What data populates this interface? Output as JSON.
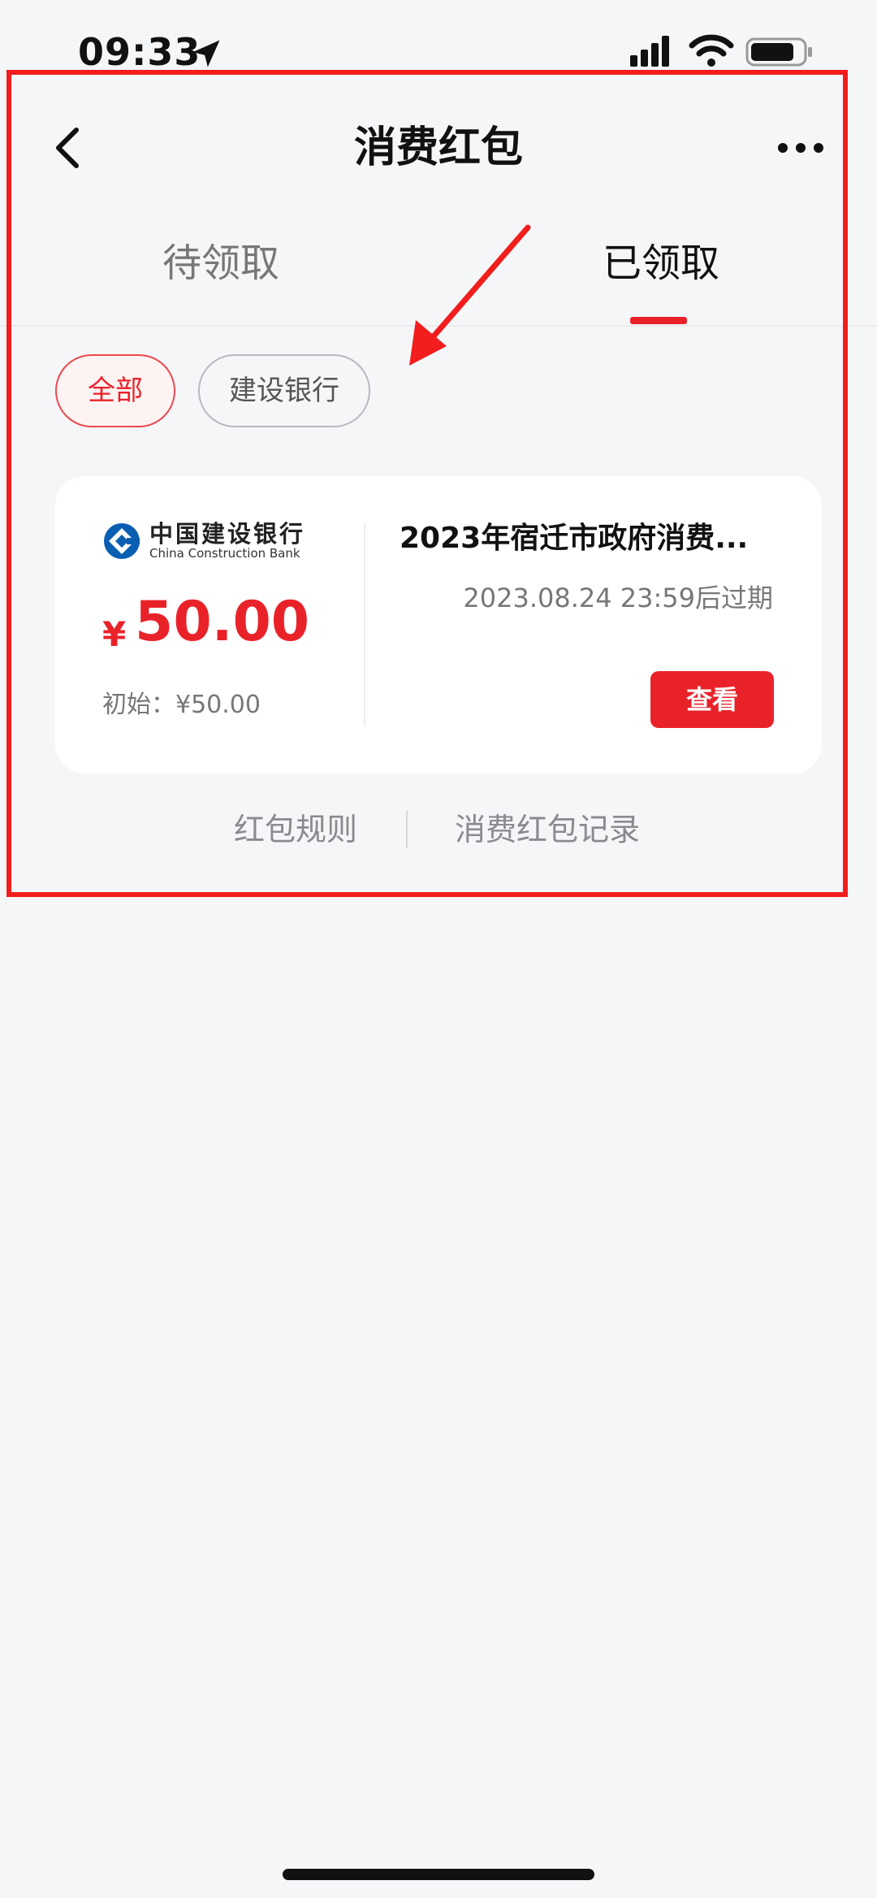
{
  "status_bar": {
    "time": "09:33",
    "icons": [
      "location-arrow-icon",
      "signal-icon",
      "wifi-icon",
      "battery-icon"
    ]
  },
  "nav": {
    "title": "消费红包",
    "back_icon": "chevron-left-icon",
    "more_icon": "more-horizontal-icon"
  },
  "tabs": [
    {
      "label": "待领取",
      "active": false
    },
    {
      "label": "已领取",
      "active": true
    }
  ],
  "filters": [
    {
      "label": "全部",
      "selected": true
    },
    {
      "label": "建设银行",
      "selected": false
    }
  ],
  "coupon": {
    "bank_name_cn": "中国建设银行",
    "bank_name_en": "China Construction Bank",
    "currency": "¥",
    "amount": "50.00",
    "initial": "初始：¥50.00",
    "title": "2023年宿迁市政府消费...",
    "expiry": "2023.08.24 23:59后过期",
    "view_button": "查看"
  },
  "footer": {
    "rules_link": "红包规则",
    "records_link": "消费红包记录"
  },
  "colors": {
    "accent": "#e9222a",
    "annotation": "#f21d1d",
    "background": "#f5f6f8"
  }
}
